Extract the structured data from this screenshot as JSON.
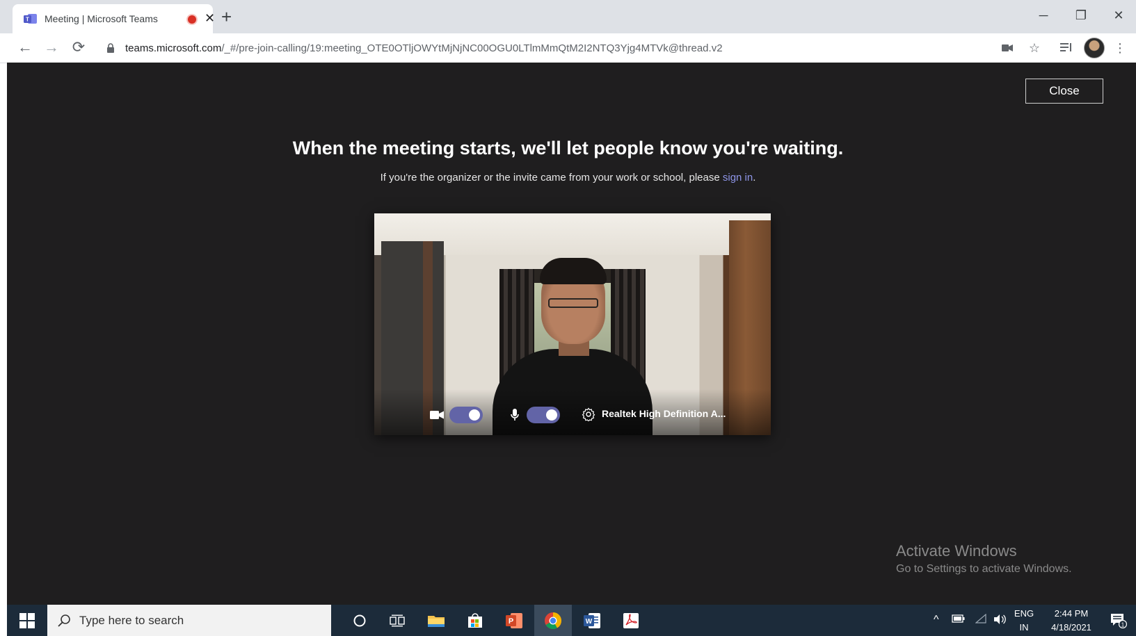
{
  "browser": {
    "tab_title": "Meeting | Microsoft Teams",
    "tab_close": "✕",
    "new_tab": "+",
    "url_host": "teams.microsoft.com",
    "url_path": "/_#/pre-join-calling/19:meeting_OTE0OTljOWYtMjNjNC00OGU0LTlmMmQtM2I2NTQ3Yjg4MTVk@thread.v2",
    "window_controls": {
      "minimize": "─",
      "restore": "❐",
      "close": "✕"
    },
    "nav": {
      "back": "←",
      "forward": "→",
      "reload": "⟳"
    }
  },
  "prejoin": {
    "close_label": "Close",
    "headline": "When the meeting starts, we'll let people know you're waiting.",
    "subtext_before": "If you're the organizer or the invite came from your work or school, please ",
    "sign_in_link": "sign in",
    "subtext_after": ".",
    "device_label": "Realtek High Definition A..."
  },
  "watermark": {
    "title": "Activate Windows",
    "subtitle": "Go to Settings to activate Windows."
  },
  "taskbar": {
    "search_placeholder": "Type here to search",
    "lang_top": "ENG",
    "lang_bottom": "IN",
    "time": "2:44 PM",
    "date": "4/18/2021",
    "notification_count": "1"
  },
  "colors": {
    "teams_accent": "#6264a7",
    "link": "#8e95e8",
    "background": "#1f1e1f",
    "taskbar": "#1c2b3a"
  }
}
